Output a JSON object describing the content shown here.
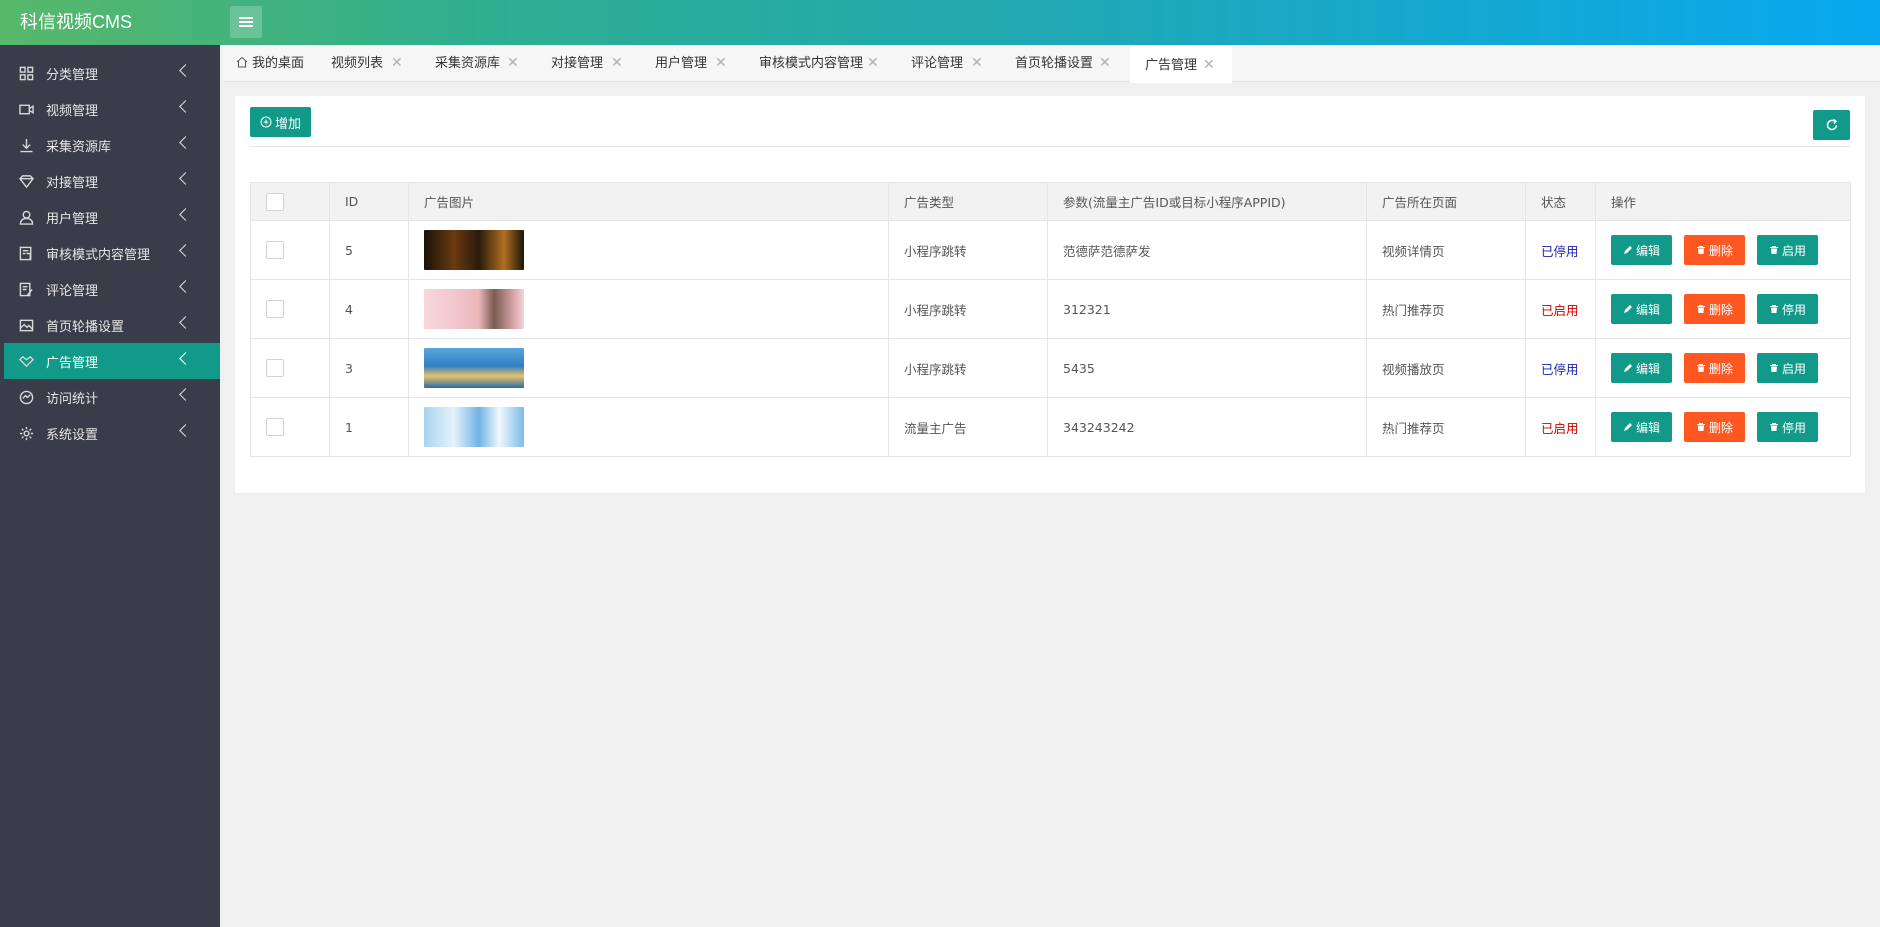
{
  "app": {
    "title": "科信视频CMS"
  },
  "sidebar": {
    "items": [
      {
        "label": "分类管理",
        "icon": "grid-icon"
      },
      {
        "label": "视频管理",
        "icon": "video-icon"
      },
      {
        "label": "采集资源库",
        "icon": "download-icon"
      },
      {
        "label": "对接管理",
        "icon": "diamond-icon"
      },
      {
        "label": "用户管理",
        "icon": "user-icon"
      },
      {
        "label": "审核模式内容管理",
        "icon": "document-icon"
      },
      {
        "label": "评论管理",
        "icon": "edit-icon"
      },
      {
        "label": "首页轮播设置",
        "icon": "image-icon"
      },
      {
        "label": "广告管理",
        "icon": "handshake-icon",
        "active": true
      },
      {
        "label": "访问统计",
        "icon": "chart-icon"
      },
      {
        "label": "系统设置",
        "icon": "gear-icon"
      }
    ]
  },
  "tabs": [
    {
      "label": "我的桌面",
      "closable": false
    },
    {
      "label": "视频列表",
      "closable": true
    },
    {
      "label": "采集资源库",
      "closable": true
    },
    {
      "label": "对接管理",
      "closable": true
    },
    {
      "label": "用户管理",
      "closable": true
    },
    {
      "label": "审核模式内容管理",
      "closable": true
    },
    {
      "label": "评论管理",
      "closable": true
    },
    {
      "label": "首页轮播设置",
      "closable": true
    },
    {
      "label": "广告管理",
      "closable": true,
      "active": true
    }
  ],
  "toolbar": {
    "add_label": "增加"
  },
  "table": {
    "headers": [
      "ID",
      "广告图片",
      "广告类型",
      "参数(流量主广告ID或目标小程序APPID)",
      "广告所在页面",
      "状态",
      "操作"
    ],
    "actions": {
      "edit": "编辑",
      "delete": "删除"
    },
    "rows": [
      {
        "id": "5",
        "type": "小程序跳转",
        "param": "范德萨范德萨发",
        "page": "视频详情页",
        "status": "已停用",
        "toggle": "启用"
      },
      {
        "id": "4",
        "type": "小程序跳转",
        "param": "312321",
        "page": "热门推荐页",
        "status": "已启用",
        "toggle": "停用"
      },
      {
        "id": "3",
        "type": "小程序跳转",
        "param": "5435",
        "page": "视频播放页",
        "status": "已停用",
        "toggle": "启用"
      },
      {
        "id": "1",
        "type": "流量主广告",
        "param": "343243242",
        "page": "热门推荐页",
        "status": "已启用",
        "toggle": "停用"
      }
    ]
  },
  "colors": {
    "accent": "#11998a",
    "danger": "#ff5722",
    "sidebar": "#393d49"
  }
}
